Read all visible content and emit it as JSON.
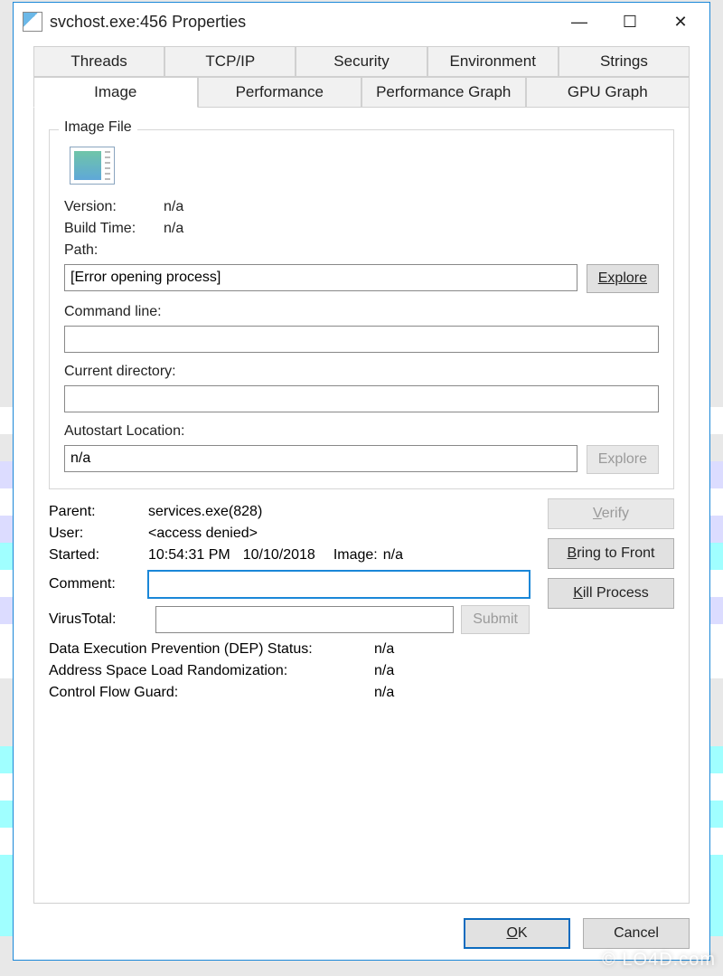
{
  "window": {
    "title": "svchost.exe:456 Properties"
  },
  "tabs": {
    "row1": [
      "Threads",
      "TCP/IP",
      "Security",
      "Environment",
      "Strings"
    ],
    "row2": [
      "Image",
      "Performance",
      "Performance Graph",
      "GPU Graph"
    ],
    "active": "Image"
  },
  "imageFile": {
    "group_label": "Image File",
    "version_label": "Version:",
    "version_value": "n/a",
    "buildtime_label": "Build Time:",
    "buildtime_value": "n/a",
    "path_label": "Path:",
    "path_value": "[Error opening process]",
    "explore_label": "Explore",
    "cmdline_label": "Command line:",
    "cmdline_value": "",
    "curdir_label": "Current directory:",
    "curdir_value": "",
    "autostart_label": "Autostart Location:",
    "autostart_value": "n/a",
    "explore2_label": "Explore"
  },
  "details": {
    "parent_label": "Parent:",
    "parent_value": "services.exe(828)",
    "user_label": "User:",
    "user_value": "<access denied>",
    "started_label": "Started:",
    "started_time": "10:54:31 PM",
    "started_date": "10/10/2018",
    "image_label": "Image:",
    "image_value": "n/a",
    "comment_label": "Comment:",
    "comment_value": "",
    "vt_label": "VirusTotal:",
    "vt_value": "",
    "submit_label": "Submit",
    "dep_label": "Data Execution Prevention (DEP) Status:",
    "dep_value": "n/a",
    "aslr_label": "Address Space Load Randomization:",
    "aslr_value": "n/a",
    "cfg_label": "Control Flow Guard:",
    "cfg_value": "n/a"
  },
  "sidebuttons": {
    "verify": "Verify",
    "bring": "Bring to Front",
    "kill": "Kill Process"
  },
  "footer": {
    "ok": "OK",
    "cancel": "Cancel"
  },
  "watermark": "© LO4D.com"
}
